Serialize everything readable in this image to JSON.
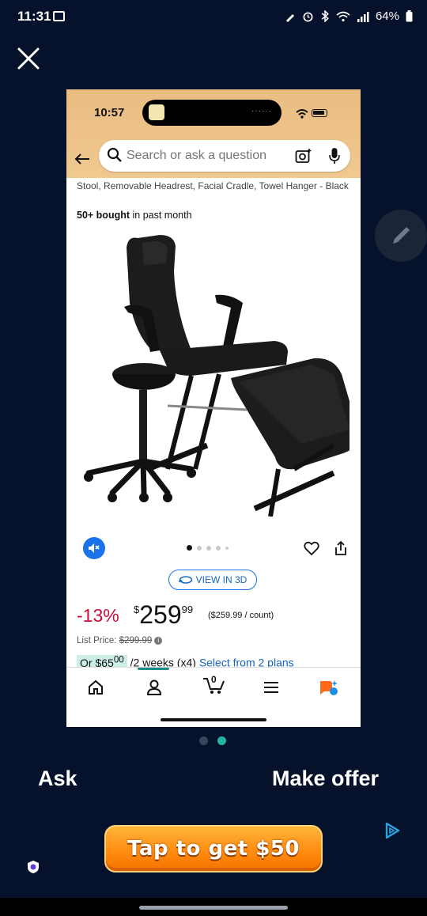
{
  "status_bar": {
    "time": "11:31",
    "battery": "64%"
  },
  "inner": {
    "time": "10:57",
    "search": {
      "placeholder": "Search or ask a question"
    },
    "product": {
      "title": "Stool, Removable Headrest, Facial Cradle, Towel Hanger - Black",
      "bought_count": "50+ bought",
      "bought_suffix": " in past month",
      "image_alt": "Black salon facial bed chair with adjustable stool"
    },
    "carousel": {
      "dots": 5,
      "active_index": 0
    },
    "view3d_label": "VIEW IN 3D",
    "price": {
      "discount": "-13%",
      "currency": "$",
      "whole": "259",
      "fraction": "99",
      "unit_price": "($259.99 / count)",
      "list_price_label": "List Price: ",
      "list_price": "$299.99",
      "installment_or": "Or $65",
      "installment_cents": "00",
      "installment_rest": " /2 weeks (x4) ",
      "installment_link": "Select from 2 plans"
    },
    "bottom_nav": [
      "home",
      "account",
      "cart",
      "menu",
      "rufus"
    ],
    "cart_count": "0"
  },
  "page_dots": {
    "count": 2,
    "active_index": 1
  },
  "actions": {
    "ask": "Ask",
    "offer": "Make offer"
  },
  "ad": {
    "text": "Tap to get $50"
  },
  "colors": {
    "background": "#06122b",
    "accent_teal": "#22b5a0",
    "amazon_header": "#f0c890",
    "discount_red": "#cc0c39"
  }
}
